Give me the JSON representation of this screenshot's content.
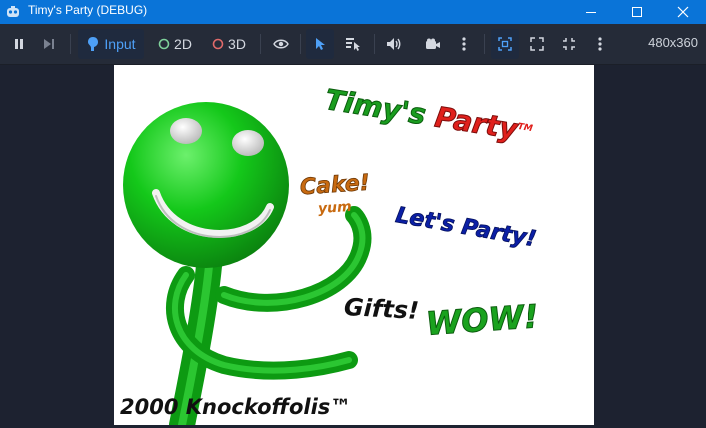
{
  "window": {
    "title": "Timy's Party (DEBUG)",
    "icons": [
      "app-icon",
      "minimize-icon",
      "maximize-icon",
      "close-icon"
    ]
  },
  "toolbar": {
    "input_label": "Input",
    "mode_2d_label": "2D",
    "mode_3d_label": "3D",
    "resolution": "480x360",
    "icons": [
      "pause-icon",
      "next-frame-icon",
      "input-icon",
      "2d-mode-icon",
      "3d-mode-icon",
      "eye-icon",
      "select-arrow-icon",
      "list-select-icon",
      "speaker-icon",
      "camera-icon",
      "more-icon",
      "focus-frame-icon",
      "expand-icon",
      "fullscreen-icon",
      "more-icon"
    ]
  },
  "game": {
    "title_part1": "Timy's",
    "title_part2": "Party",
    "title_tm": "TM",
    "cake": "Cake!",
    "yum": "yum",
    "lets_party": "Let's Party!",
    "gifts": "Gifts!",
    "wow": "WOW!",
    "footer": "2000 Knockoffolis™",
    "colors": {
      "figure_green": "#13c81a",
      "title_green": "#1a9d1f",
      "title_red": "#e0201c",
      "cake_orange": "#c86a10",
      "lets_blue": "#0b1fa6",
      "wow_green": "#1aa21e",
      "black": "#111111"
    }
  },
  "colors": {
    "titlebar": "#0a74d8",
    "toolbar": "#252b38",
    "background": "#1d2230",
    "accent_blue": "#4ea0f7",
    "mode_2d": "#7fd19b",
    "mode_3d": "#e06a6a"
  }
}
